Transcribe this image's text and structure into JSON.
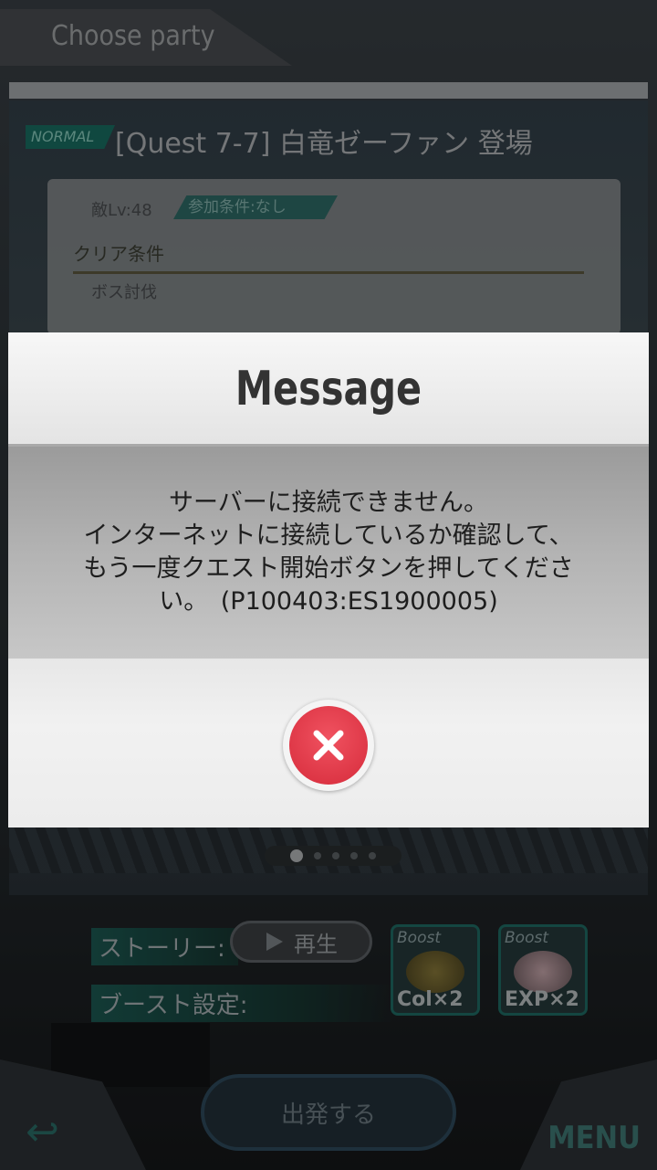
{
  "header": {
    "title": "Choose party"
  },
  "quest": {
    "difficulty": "NORMAL",
    "title": "[Quest 7-7] 白竜ゼーファン 登場",
    "level": "敵Lv:48",
    "condition": "参加条件:なし",
    "clear_heading": "クリア条件",
    "clear_value": "ボス討伐"
  },
  "story": {
    "label": "ストーリー:",
    "play_label": "再生"
  },
  "boost": {
    "label": "ブースト設定:",
    "items": [
      {
        "tag": "Boost",
        "value": "Col×2"
      },
      {
        "tag": "Boost",
        "value": "EXP×2"
      }
    ]
  },
  "actions": {
    "depart_label": "出発する",
    "menu_label": "MENU"
  },
  "dialog": {
    "title": "Message",
    "lines": [
      "サーバーに接続できません。",
      "インターネットに接続しているか確認して、",
      "もう一度クエスト開始ボタンを押してくださ",
      "い。　(P100403:ES1900005)"
    ]
  },
  "colors": {
    "close_button": "#e23a4a",
    "accent_teal": "#1f6c64"
  },
  "icons": {
    "close": "close-icon",
    "play": "play-icon",
    "back": "back-arrow-icon"
  }
}
